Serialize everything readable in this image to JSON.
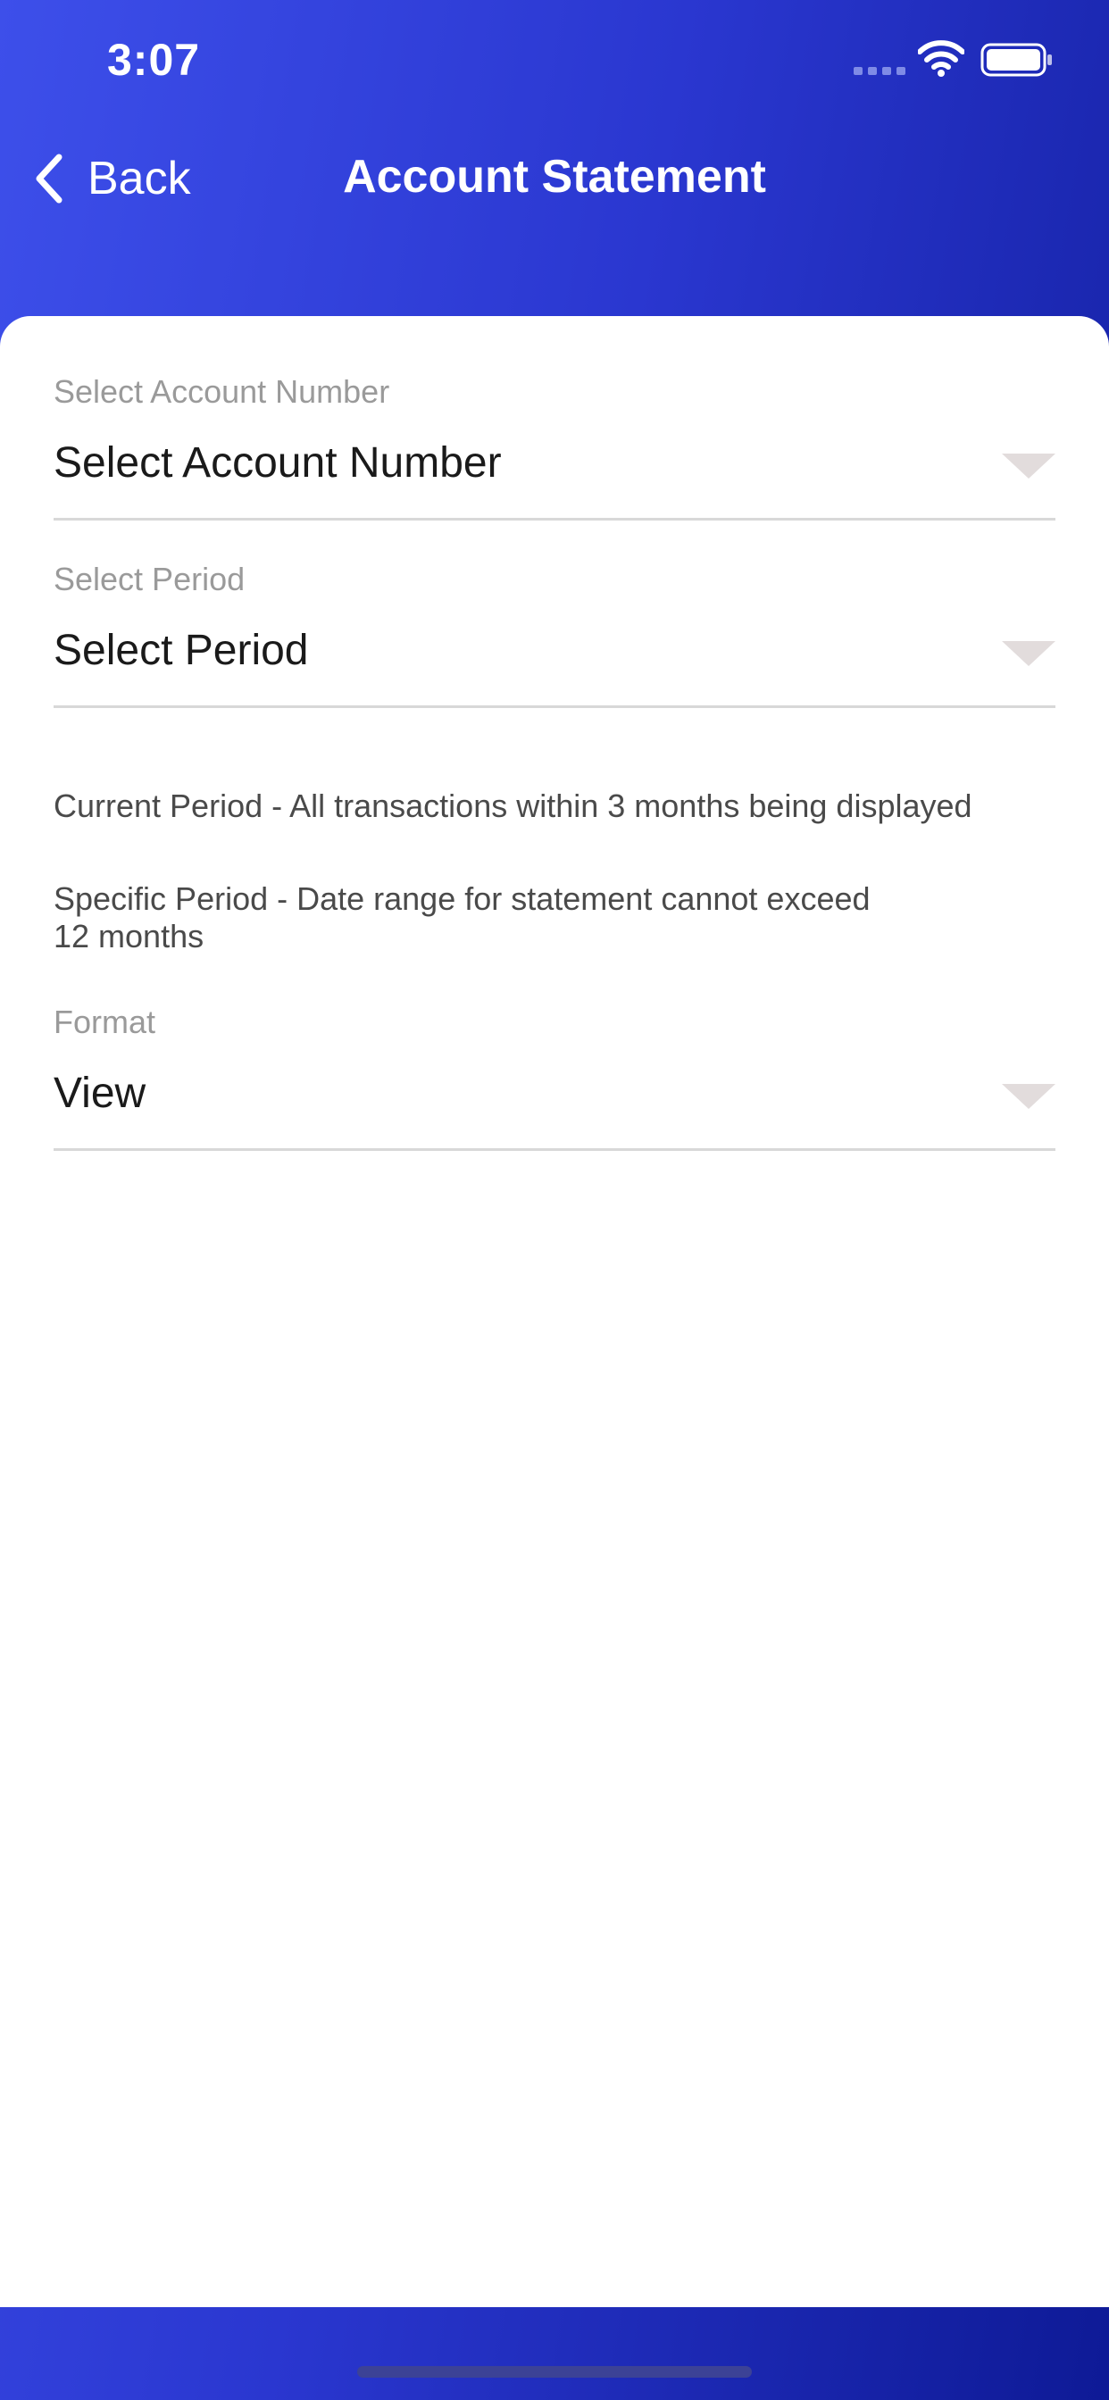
{
  "status_bar": {
    "time": "3:07",
    "signal_icon": "cellular-signal-icon",
    "wifi_icon": "wifi-icon",
    "battery_icon": "battery-full-icon"
  },
  "nav": {
    "back_label": "Back",
    "back_icon": "chevron-left-icon",
    "title": "Account Statement"
  },
  "form": {
    "account": {
      "label": "Select Account Number",
      "value": "Select Account Number"
    },
    "period": {
      "label": "Select Period",
      "value": "Select Period"
    },
    "format": {
      "label": "Format",
      "value": "View"
    },
    "dropdown_icon": "dropdown-triangle-icon"
  },
  "info": {
    "current_period": "Current Period - All transactions within 3 months being displayed",
    "specific_period_line1": "Specific Period - Date range for statement cannot exceed",
    "specific_period_line2": "12 months"
  },
  "colors": {
    "header_gradient_start": "#3d4fea",
    "header_gradient_end": "#0e1a96",
    "card_background": "#ffffff",
    "label_gray": "#9a9a9a",
    "divider": "#d8d8d8",
    "dropdown_arrow": "#e2dcdc"
  }
}
